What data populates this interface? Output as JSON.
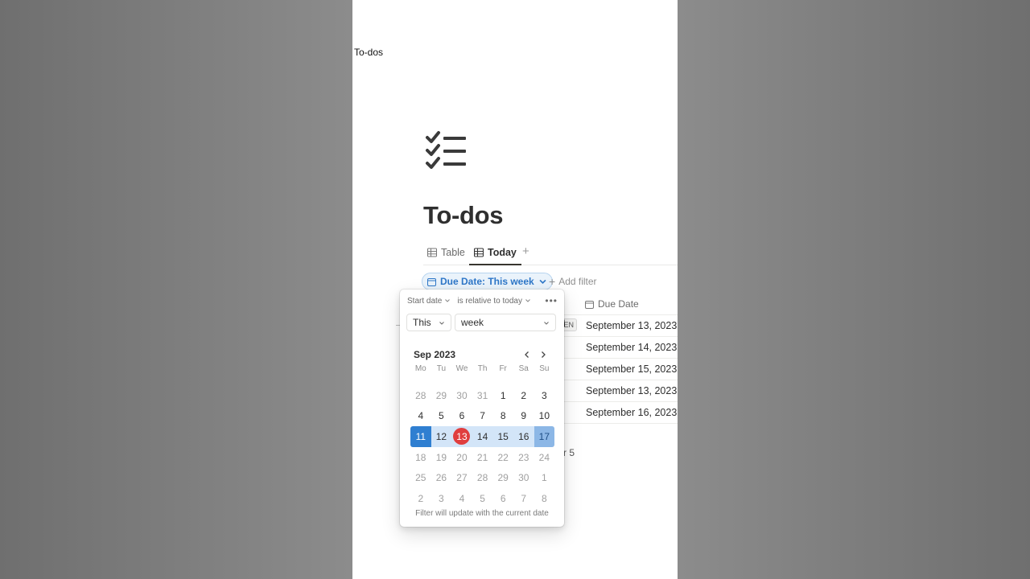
{
  "browser": {
    "tab_title": "To-dos"
  },
  "page": {
    "icon": "checklist-icon",
    "title": "To-dos"
  },
  "views": [
    {
      "label": "Table",
      "icon": "table-icon"
    },
    {
      "label": "Today",
      "icon": "table-icon",
      "active": true
    }
  ],
  "filter": {
    "chip_label": "Due Date: This week",
    "add_filter_label": "Add filter"
  },
  "table": {
    "column_header": "Due Date",
    "badge": "EN",
    "rows": [
      {
        "due_date": "September 13, 2023"
      },
      {
        "due_date": "September 14, 2023"
      },
      {
        "due_date": "September 15, 2023"
      },
      {
        "due_date": "September 13, 2023"
      },
      {
        "due_date": "September 16, 2023"
      }
    ],
    "count_fragment": "r 5"
  },
  "date_filter": {
    "date_type": "Start date",
    "relation": "is relative to today",
    "relative_select": "This",
    "unit_select": "week",
    "month_label": "Sep 2023",
    "weekdays": [
      "Mo",
      "Tu",
      "We",
      "Th",
      "Fr",
      "Sa",
      "Su"
    ],
    "days": [
      {
        "label": "28",
        "muted": true
      },
      {
        "label": "29",
        "muted": true
      },
      {
        "label": "30",
        "muted": true
      },
      {
        "label": "31",
        "muted": true
      },
      {
        "label": "1"
      },
      {
        "label": "2"
      },
      {
        "label": "3"
      },
      {
        "label": "4"
      },
      {
        "label": "5"
      },
      {
        "label": "6"
      },
      {
        "label": "7"
      },
      {
        "label": "8"
      },
      {
        "label": "9"
      },
      {
        "label": "10"
      },
      {
        "label": "11",
        "state": "start"
      },
      {
        "label": "12",
        "state": "range"
      },
      {
        "label": "13",
        "state": "today"
      },
      {
        "label": "14",
        "state": "range"
      },
      {
        "label": "15",
        "state": "range"
      },
      {
        "label": "16",
        "state": "range"
      },
      {
        "label": "17",
        "state": "end"
      },
      {
        "label": "18",
        "muted": true
      },
      {
        "label": "19",
        "muted": true
      },
      {
        "label": "20",
        "muted": true
      },
      {
        "label": "21",
        "muted": true
      },
      {
        "label": "22",
        "muted": true
      },
      {
        "label": "23",
        "muted": true
      },
      {
        "label": "24",
        "muted": true
      },
      {
        "label": "25",
        "muted": true
      },
      {
        "label": "26",
        "muted": true
      },
      {
        "label": "27",
        "muted": true
      },
      {
        "label": "28",
        "muted": true
      },
      {
        "label": "29",
        "muted": true
      },
      {
        "label": "30",
        "muted": true
      },
      {
        "label": "1",
        "muted": true
      },
      {
        "label": "2",
        "muted": true
      },
      {
        "label": "3",
        "muted": true
      },
      {
        "label": "4",
        "muted": true
      },
      {
        "label": "5",
        "muted": true
      },
      {
        "label": "6",
        "muted": true
      },
      {
        "label": "7",
        "muted": true
      },
      {
        "label": "8",
        "muted": true
      }
    ],
    "footer": "Filter will update with the current date"
  },
  "colors": {
    "accent": "#2f7fd1",
    "range": "#d3e5f8",
    "today": "#e03e3e",
    "chip_text": "#2e77c8"
  }
}
